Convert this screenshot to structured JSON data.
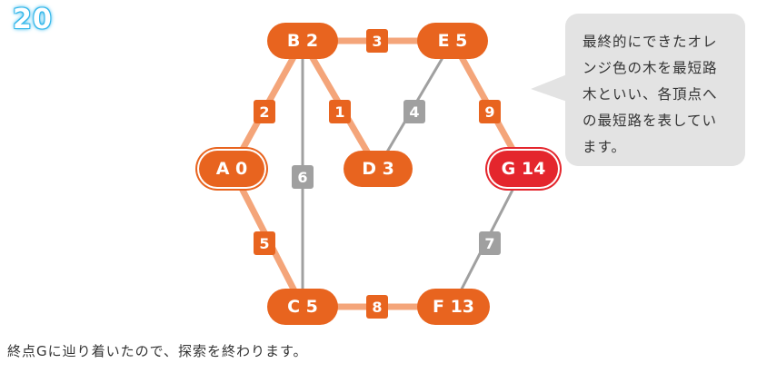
{
  "step_number": "20",
  "colors": {
    "orange": "#e8641f",
    "goal": "#e4262d",
    "gray": "#a0a0a0",
    "bubble": "#e3e3e3"
  },
  "nodes": [
    {
      "id": "A",
      "label": "A 0",
      "state": "start"
    },
    {
      "id": "B",
      "label": "B 2",
      "state": "visited"
    },
    {
      "id": "C",
      "label": "C 5",
      "state": "visited"
    },
    {
      "id": "D",
      "label": "D 3",
      "state": "visited"
    },
    {
      "id": "E",
      "label": "E 5",
      "state": "visited"
    },
    {
      "id": "F",
      "label": "F 13",
      "state": "visited"
    },
    {
      "id": "G",
      "label": "G 14",
      "state": "goal"
    }
  ],
  "edges": [
    {
      "from": "A",
      "to": "B",
      "weight": "2",
      "in_tree": true
    },
    {
      "from": "A",
      "to": "C",
      "weight": "5",
      "in_tree": true
    },
    {
      "from": "B",
      "to": "C",
      "weight": "6",
      "in_tree": false
    },
    {
      "from": "B",
      "to": "D",
      "weight": "1",
      "in_tree": true
    },
    {
      "from": "B",
      "to": "E",
      "weight": "3",
      "in_tree": true
    },
    {
      "from": "D",
      "to": "E",
      "weight": "4",
      "in_tree": false
    },
    {
      "from": "E",
      "to": "G",
      "weight": "9",
      "in_tree": true
    },
    {
      "from": "C",
      "to": "F",
      "weight": "8",
      "in_tree": true
    },
    {
      "from": "F",
      "to": "G",
      "weight": "7",
      "in_tree": false
    }
  ],
  "bubble_text": "最終的にできたオレ\nンジ色の木を最短路\n木といい、各頂点へ\nの最短路を表してい\nます。",
  "caption": "終点Gに辿り着いたので、探索を終わります。"
}
